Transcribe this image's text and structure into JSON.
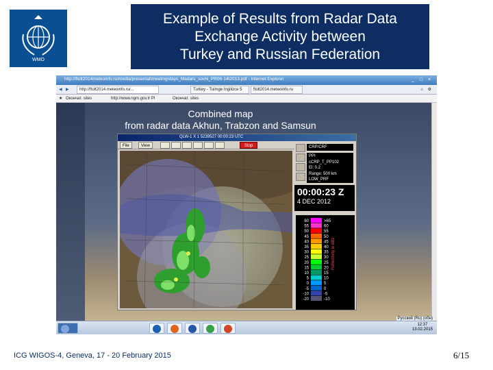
{
  "slide": {
    "title": "Example of Results from Radar Data\nExchange Activity between\nTurkey and Russian Federation",
    "footer_left": "ICG WIGOS-4, Geneva, 17 - 20 February 2015",
    "page_number": "6/15",
    "logo_icon": "wmo-emblem-icon",
    "colors": {
      "logo_bg": "#0b4f93",
      "title_bg": "#0d2d63"
    }
  },
  "browser": {
    "title": "http://ftolt2014meteoinfo.ru/media/presentat\\meeting\\days_Madars_sochi_PR06-14\\2013.pdf - Internet Explorer",
    "address": "http://ftolt2014.meteoinfo.ru/...",
    "tabs": [
      "Turkey - Tuimge Ingilizce 5",
      "ftolt2014.meteoinfo.ru"
    ],
    "favorites": [
      "Окончат. sitеs",
      "http://www.ngm.gov.tr PI",
      "Окончат. sitеs"
    ],
    "content_title": "Combined map\nfrom radar data Akhun, Trabzon and Samsun",
    "tray_label": "Русский (Ru) (обн)",
    "clock_time": "12:37",
    "clock_date": "13.02.2015"
  },
  "radar_app": {
    "title": "QLW-1  X 1  5239527  00:00:23 UTC",
    "menu": [
      "File",
      "View"
    ],
    "stop_label": "Stop",
    "mode": "CRP/CRF",
    "info_lines": [
      "PPI",
      "cCRP_T_PP102",
      "El: 0.2",
      "Range: 500 km",
      "LOW_PRF"
    ],
    "time": "00:00:23 Z",
    "date": "4 DEC 2012",
    "legend_left": [
      "60",
      "55",
      "50",
      "45",
      "40",
      "35",
      "30",
      "25",
      "20",
      "15",
      "10",
      "5",
      "0",
      "-5",
      "-10",
      "-20"
    ],
    "legend_right": [
      ">65",
      "60",
      "55",
      "50",
      "45",
      "40",
      "35",
      "30",
      "25",
      "20",
      "15",
      "10",
      "5",
      "0",
      "-5",
      "-10"
    ],
    "legend_colors": [
      "#ff00ff",
      "#ff33cc",
      "#ff0000",
      "#ff6600",
      "#ff9900",
      "#ffcc00",
      "#ffff00",
      "#ccff33",
      "#00ff00",
      "#00cc33",
      "#009966",
      "#00cccc",
      "#0099ff",
      "#0066cc",
      "#3344aa",
      "#555577"
    ],
    "legend_caption": "Reflectivity in dBz"
  }
}
